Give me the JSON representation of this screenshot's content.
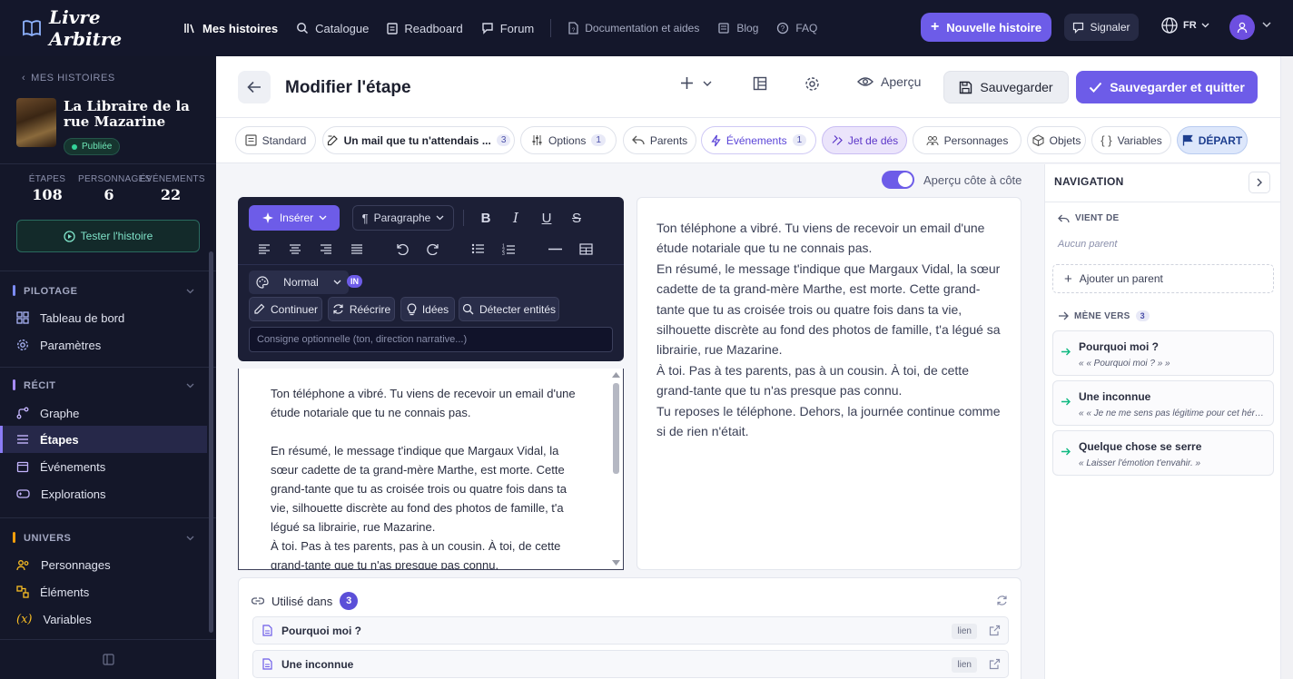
{
  "topnav": {
    "brand": "Livre Arbitre",
    "items": [
      {
        "label": "Mes histoires",
        "icon": "library-icon"
      },
      {
        "label": "Catalogue",
        "icon": "search-icon"
      },
      {
        "label": "Readboard",
        "icon": "clipboard-icon"
      },
      {
        "label": "Forum",
        "icon": "chat-icon"
      }
    ],
    "secondary": [
      {
        "label": "Documentation et aides",
        "icon": "doc-icon"
      },
      {
        "label": "Blog",
        "icon": "news-icon"
      },
      {
        "label": "FAQ",
        "icon": "help-icon"
      }
    ],
    "new_story": "Nouvelle histoire",
    "report": "Signaler",
    "lang": "FR"
  },
  "sidebar": {
    "back": "MES HISTOIRES",
    "story_title": "La Libraire de la rue Mazarine",
    "status": "Publiée",
    "stats": [
      {
        "label": "ÉTAPES",
        "value": "108"
      },
      {
        "label": "PERSONNAGES",
        "value": "6"
      },
      {
        "label": "ÉVÉNEMENTS",
        "value": "22"
      }
    ],
    "test_button": "Tester l'histoire",
    "sections": {
      "pilotage": "PILOTAGE",
      "recit": "RÉCIT",
      "univers": "UNIVERS"
    },
    "items": {
      "dashboard": "Tableau de bord",
      "settings": "Paramètres",
      "graph": "Graphe",
      "steps": "Étapes",
      "events": "Événements",
      "explorations": "Explorations",
      "characters": "Personnages",
      "elements": "Éléments",
      "variables": "Variables"
    }
  },
  "header": {
    "title": "Modifier l'étape",
    "preview": "Aperçu",
    "save": "Sauvegarder",
    "save_quit": "Sauvegarder et quitter"
  },
  "tabs": {
    "standard": "Standard",
    "mail": "Un mail que tu n'attendais ...",
    "mail_count": "3",
    "options": "Options",
    "options_count": "1",
    "parents": "Parents",
    "events": "Événements",
    "events_count": "1",
    "dice": "Jet de dés",
    "characters": "Personnages",
    "objects": "Objets",
    "variables": "Variables",
    "depart": "DÉPART"
  },
  "editor": {
    "side_preview_label": "Aperçu côte à côte",
    "insert": "Insérer",
    "paragraph": "Paragraphe",
    "ai_mode": "Normal",
    "ai_badge": "IN",
    "ai_continue": "Continuer",
    "ai_rewrite": "Réécrire",
    "ai_ideas": "Idées",
    "ai_detect": "Détecter entités",
    "ai_placeholder": "Consigne optionnelle (ton, direction narrative...)",
    "p1": "Ton téléphone a vibré. Tu viens de recevoir un email d'une étude notariale que tu ne connais pas.",
    "p2": "En résumé, le message t'indique que Margaux Vidal, la sœur cadette de ta grand-mère Marthe, est morte. Cette grand-tante que tu as croisée trois ou quatre fois dans ta vie, silhouette discrète au fond des photos de famille, t'a légué sa librairie, rue Mazarine.",
    "p3": "À toi. Pas à tes parents, pas à un cousin. À toi, de cette grand-tante que tu n'as presque pas connu."
  },
  "preview": {
    "l1": "Ton téléphone a vibré. Tu viens de recevoir un email d'une étude notariale que tu ne connais pas.",
    "l2": "En résumé, le message t'indique que Margaux Vidal, la sœur cadette de ta grand-mère Marthe, est morte. Cette grand-tante que tu as croisée trois ou quatre fois dans ta vie, silhouette discrète au fond des photos de famille, t'a légué sa librairie, rue Mazarine.",
    "l3": "À toi. Pas à tes parents, pas à un cousin. À toi, de cette grand-tante que tu n'as presque pas connu.",
    "l4": "Tu reposes le téléphone. Dehors, la journée continue comme si de rien n'était."
  },
  "used_in": {
    "title": "Utilisé dans",
    "count": "3",
    "rows": [
      {
        "title": "Pourquoi moi ?",
        "tag": "lien"
      },
      {
        "title": "Une inconnue",
        "tag": "lien"
      }
    ]
  },
  "navigation": {
    "title": "NAVIGATION",
    "from_label": "VIENT DE",
    "no_parent": "Aucun parent",
    "add_parent": "Ajouter un parent",
    "to_label": "MÈNE VERS",
    "to_count": "3",
    "targets": [
      {
        "title": "Pourquoi moi ?",
        "quote": "« « Pourquoi moi ? » »"
      },
      {
        "title": "Une inconnue",
        "quote": "« « Je ne me sens pas légitime pour cet héritage » »"
      },
      {
        "title": "Quelque chose se serre",
        "quote": "« Laisser l'émotion t'envahir. »"
      }
    ]
  },
  "colors": {
    "accent": "#6d5ce8",
    "nav_bg": "#14172b",
    "published": "#34d399"
  }
}
